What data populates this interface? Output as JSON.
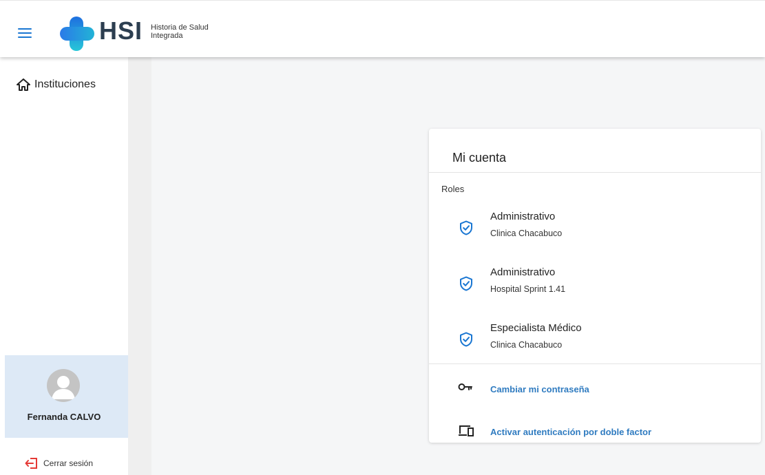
{
  "app": {
    "logo_text": "HSI",
    "logo_subtitle_line1": "Historia de Salud",
    "logo_subtitle_line2": "Integrada"
  },
  "sidebar": {
    "nav_item": "Instituciones",
    "user_name": "Fernanda CALVO",
    "logout_label": "Cerrar sesión"
  },
  "account": {
    "title": "Mi cuenta",
    "roles_label": "Roles",
    "roles": [
      {
        "name": "Administrativo",
        "institution": "Clinica Chacabuco"
      },
      {
        "name": "Administrativo",
        "institution": "Hospital Sprint 1.41"
      },
      {
        "name": "Especialista Médico",
        "institution": "Clinica Chacabuco"
      }
    ],
    "change_password_label": "Cambiar mi contraseña",
    "two_factor_label": "Activar autenticación por doble factor"
  },
  "colors": {
    "accent": "#1976d2",
    "link": "#2f7bc0",
    "profile_bg": "#dde9f6",
    "logout_icon": "#e53935"
  },
  "icons": {
    "menu": "menu-icon",
    "home": "home-icon",
    "role": "verified-shield-icon",
    "password": "key-icon",
    "two_factor": "devices-icon",
    "logout": "logout-icon"
  }
}
